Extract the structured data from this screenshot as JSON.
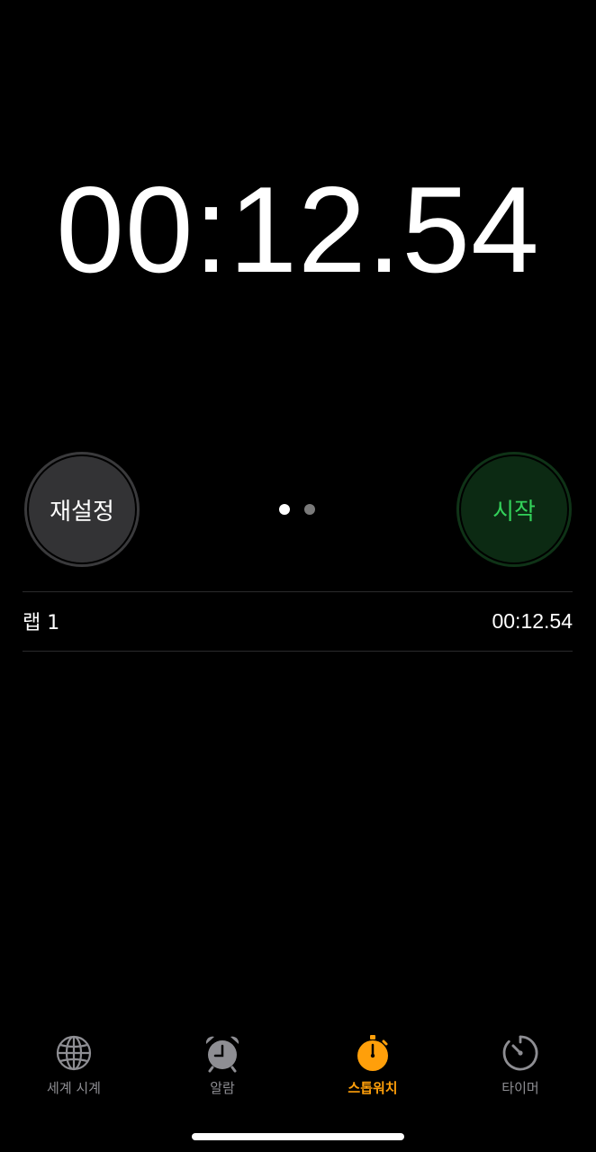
{
  "stopwatch": {
    "display_time": "00:12.54"
  },
  "controls": {
    "reset_label": "재설정",
    "start_label": "시작"
  },
  "page_indicator": {
    "total": 2,
    "current": 1
  },
  "laps": [
    {
      "label": "랩 1",
      "time": "00:12.54"
    }
  ],
  "tabs": [
    {
      "label": "세계 시계",
      "icon": "globe-icon",
      "active": false
    },
    {
      "label": "알람",
      "icon": "alarm-clock-icon",
      "active": false
    },
    {
      "label": "스톱워치",
      "icon": "stopwatch-icon",
      "active": true
    },
    {
      "label": "타이머",
      "icon": "timer-icon",
      "active": false
    }
  ],
  "colors": {
    "background": "#000000",
    "accent_active_tab": "#ff9f0a",
    "start_text": "#33d15a",
    "start_bg": "#0c2a13",
    "reset_bg": "#333335",
    "inactive_tab": "#8e8e93"
  }
}
